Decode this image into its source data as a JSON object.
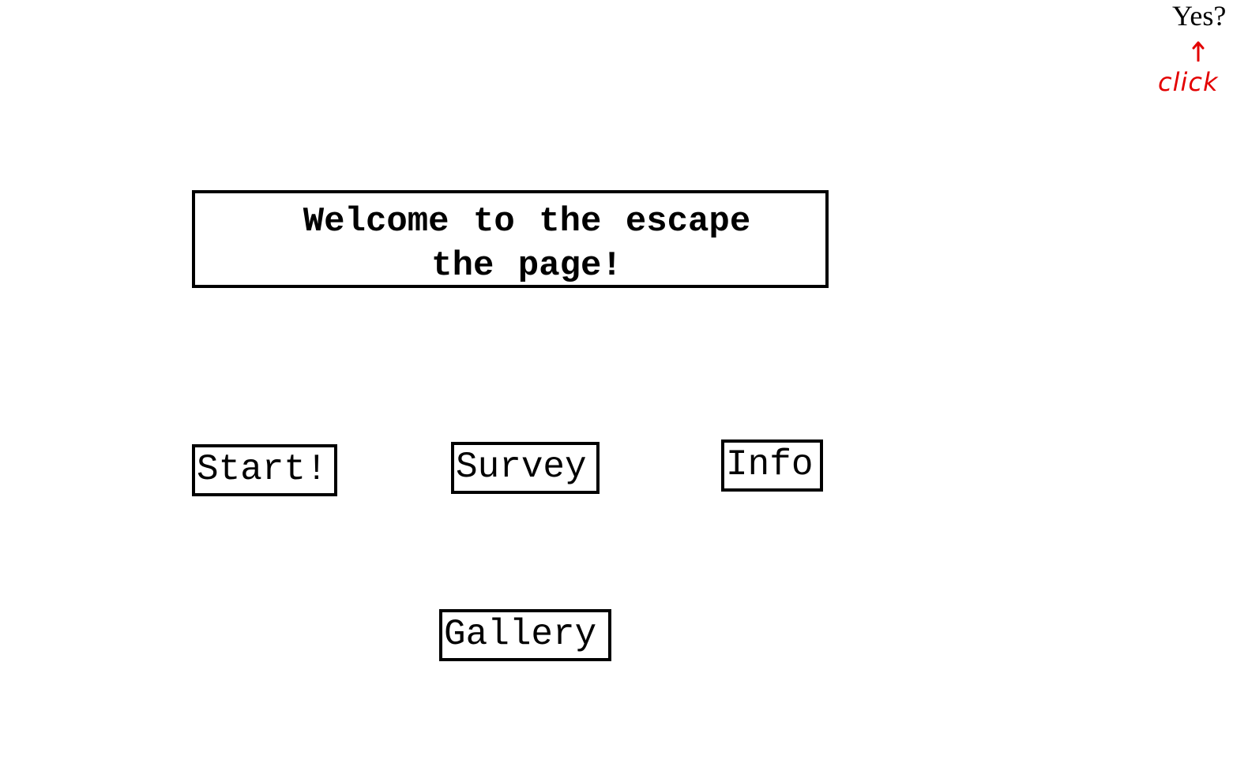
{
  "top_link": {
    "label": "Yes?"
  },
  "annotation": {
    "arrow_icon": "up-arrow-icon",
    "text": "click",
    "color": "#e30000"
  },
  "welcome": {
    "title": "Welcome to the escape the page!"
  },
  "nav": {
    "start_label": "Start!",
    "survey_label": "Survey",
    "info_label": "Info",
    "gallery_label": "Gallery"
  }
}
